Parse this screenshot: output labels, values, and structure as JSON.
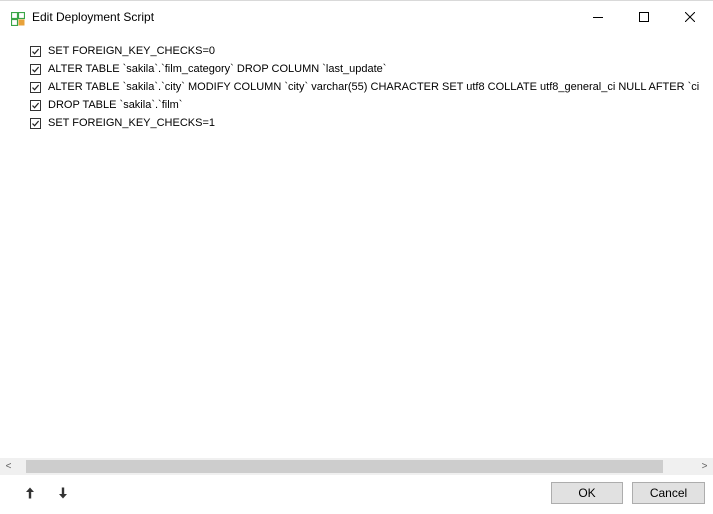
{
  "window": {
    "title": "Edit Deployment Script",
    "controls": {
      "minimize": "minimize",
      "maximize": "maximize",
      "close": "close"
    }
  },
  "statements": [
    {
      "checked": true,
      "text": "SET FOREIGN_KEY_CHECKS=0"
    },
    {
      "checked": true,
      "text": "ALTER TABLE `sakila`.`film_category` DROP COLUMN `last_update`"
    },
    {
      "checked": true,
      "text": "ALTER TABLE `sakila`.`city` MODIFY COLUMN `city` varchar(55) CHARACTER SET utf8 COLLATE utf8_general_ci NULL AFTER `ci"
    },
    {
      "checked": true,
      "text": "DROP TABLE `sakila`.`film`"
    },
    {
      "checked": true,
      "text": "SET FOREIGN_KEY_CHECKS=1"
    }
  ],
  "scrollbar": {
    "left_arrow": "<",
    "right_arrow": ">"
  },
  "footer": {
    "move_up_icon": "arrow-up-icon",
    "move_down_icon": "arrow-down-icon",
    "ok_label": "OK",
    "cancel_label": "Cancel"
  },
  "colors": {
    "accent_green": "#3aa548",
    "accent_orange": "#e8a23a",
    "button_bg": "#e1e1e1",
    "scroll_bg": "#f0f0f0"
  }
}
